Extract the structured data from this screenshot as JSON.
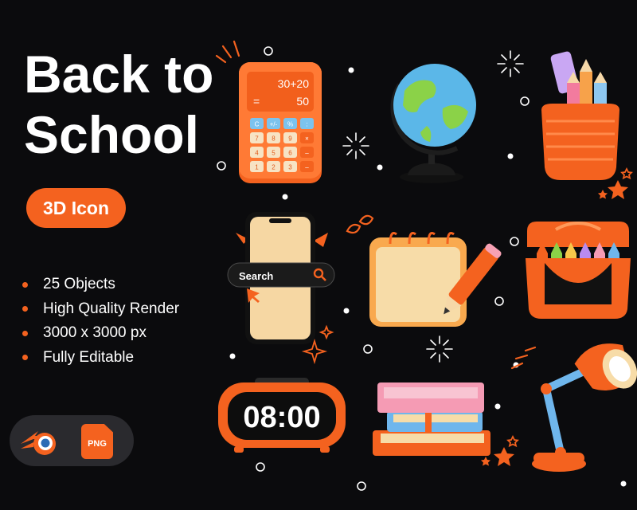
{
  "hero": {
    "title_line1": "Back to",
    "title_line2": "School",
    "badge": "3D Icon"
  },
  "features": [
    "25 Objects",
    "High Quality Render",
    "3000 x 3000 px",
    "Fully Editable"
  ],
  "software": {
    "items": [
      "blender-icon",
      "png-file-icon"
    ],
    "png_label": "PNG"
  },
  "icons": {
    "calculator": {
      "display_expression": "30+20",
      "display_result": "50",
      "display_symbol": "=",
      "keys": [
        "C",
        "+/-",
        "%",
        ":",
        "7",
        "8",
        "9",
        "×",
        "4",
        "5",
        "6",
        "–",
        "1",
        "2",
        "3",
        "–"
      ]
    },
    "phone": {
      "search_label": "Search"
    },
    "clock": {
      "time": "08:00"
    },
    "names": [
      "calculator-icon",
      "globe-icon",
      "pencil-cup-icon",
      "phone-search-icon",
      "calendar-pencil-icon",
      "crayon-box-icon",
      "alarm-clock-icon",
      "book-stack-icon",
      "desk-lamp-icon"
    ]
  },
  "colors": {
    "background": "#0b0b0d",
    "accent": "#f4621f",
    "text": "#ffffff",
    "panel": "#2a2a2e"
  }
}
